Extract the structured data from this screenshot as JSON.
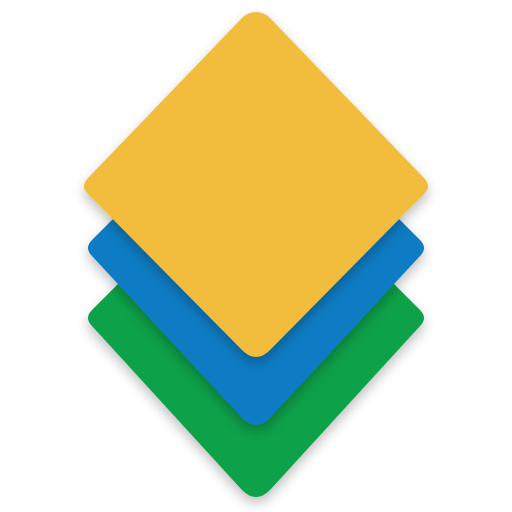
{
  "icon": {
    "name": "stacked-layers-icon",
    "layers": [
      {
        "name": "bottom-layer",
        "color": "#0AA14A"
      },
      {
        "name": "middle-layer",
        "color": "#0B7BC4"
      },
      {
        "name": "top-layer",
        "color": "#F2BC3C"
      }
    ],
    "shadow_color": "#000000"
  }
}
